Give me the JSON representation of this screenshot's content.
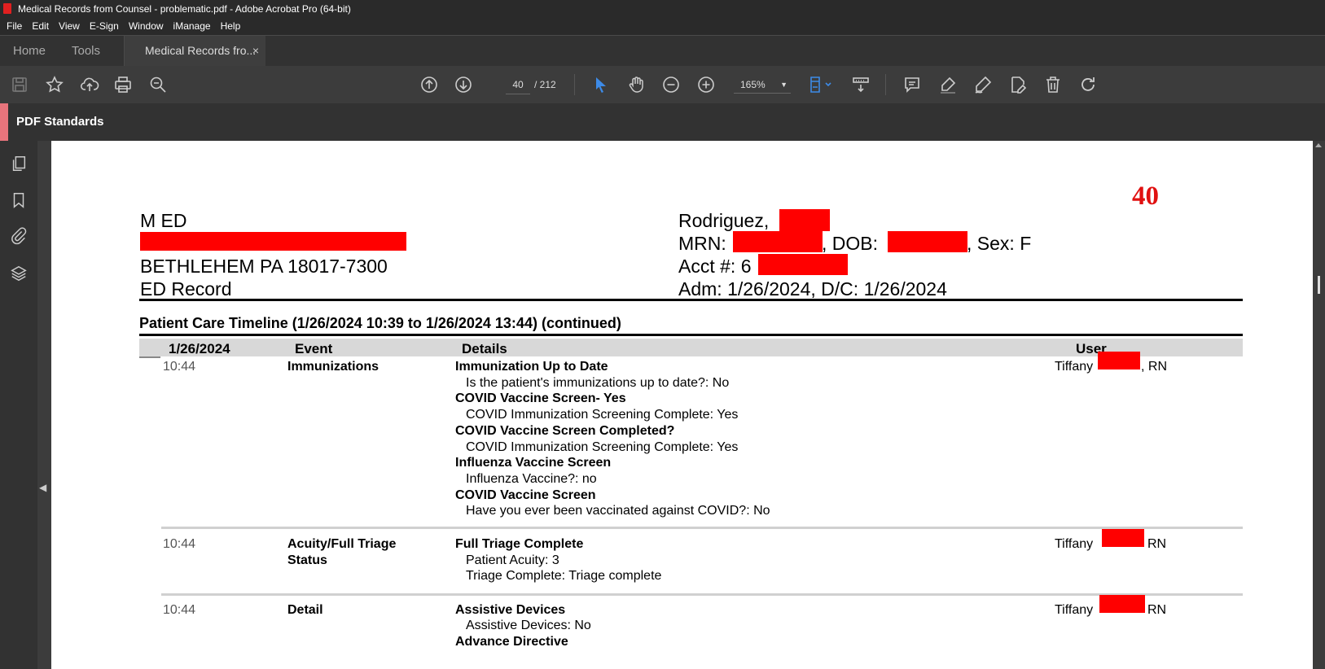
{
  "window": {
    "title": "Medical Records from Counsel - problematic.pdf - Adobe Acrobat Pro (64-bit)"
  },
  "menu": [
    "File",
    "Edit",
    "View",
    "E-Sign",
    "Window",
    "iManage",
    "Help"
  ],
  "tabs": {
    "home": "Home",
    "tools": "Tools",
    "document": "Medical Records fro...",
    "close": "×"
  },
  "toolbar": {
    "page_current": "40",
    "page_total": "/  212",
    "zoom": "165%"
  },
  "standards_panel": {
    "label": "PDF Standards"
  },
  "document": {
    "page_stamp": "40",
    "facility": {
      "line1": "M ED",
      "line3": "BETHLEHEM PA 18017-7300",
      "line4": "ED Record"
    },
    "patient": {
      "name": "Rodriguez, ",
      "mrn_label": "MRN: ",
      "dob_label": ", DOB: ",
      "sex": ", Sex: F",
      "acct_label": "Acct #: 6",
      "adm": "Adm: 1/26/2024, D/C: 1/26/2024"
    },
    "timeline_title": "Patient Care Timeline (1/26/2024 10:39 to 1/26/2024 13:44) (continued)",
    "columns": {
      "date": "1/26/2024",
      "event": "Event",
      "details": "Details",
      "user": "User"
    },
    "rows": [
      {
        "time": "10:44",
        "event": "Immunizations",
        "user_first": "Tiffany",
        "user_suffix": ", RN",
        "details": [
          {
            "h": "Immunization Up to Date",
            "v": "Is the patient's immunizations up to date?:  No"
          },
          {
            "h": "COVID Vaccine Screen- Yes",
            "v": "COVID Immunization Screening Complete:  Yes"
          },
          {
            "h": "COVID Vaccine Screen Completed?",
            "v": "COVID Immunization Screening Complete:  Yes"
          },
          {
            "h": "Influenza Vaccine Screen",
            "v": "Influenza Vaccine?:  no"
          },
          {
            "h": "COVID Vaccine Screen",
            "v": "Have you ever been vaccinated against COVID?:  No"
          }
        ]
      },
      {
        "time": "10:44",
        "event_line1": "Acuity/Full Triage",
        "event_line2": "Status",
        "user_first": "Tiffany",
        "user_suffix": "RN",
        "detail_head": "Full Triage Complete",
        "detail_v1": "Patient Acuity:  3",
        "detail_v2": "Triage Complete:  Triage complete"
      },
      {
        "time": "10:44",
        "event": "Detail",
        "user_first": "Tiffany",
        "user_suffix": "RN",
        "detail_head": "Assistive Devices",
        "detail_v1": "Assistive Devices:  No",
        "detail_head2": "Advance Directive"
      }
    ]
  }
}
